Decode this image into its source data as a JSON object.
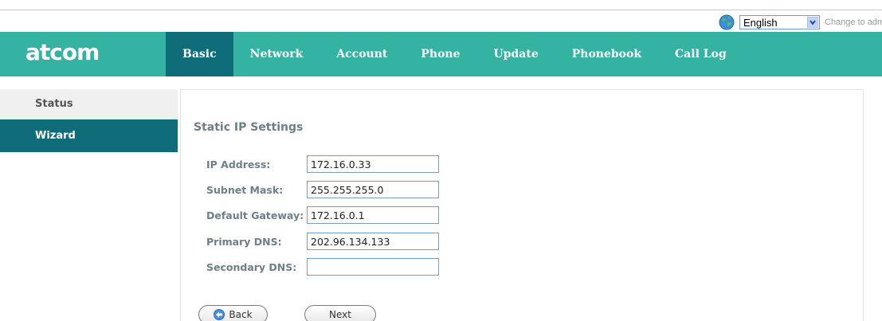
{
  "language": {
    "selected": "English",
    "change_text": "Change to admi"
  },
  "brand": {
    "logo": "atcom"
  },
  "nav": {
    "items": [
      {
        "label": "Basic",
        "active": true
      },
      {
        "label": "Network",
        "active": false
      },
      {
        "label": "Account",
        "active": false
      },
      {
        "label": "Phone",
        "active": false
      },
      {
        "label": "Update",
        "active": false
      },
      {
        "label": "Phonebook",
        "active": false
      },
      {
        "label": "Call Log",
        "active": false
      }
    ]
  },
  "sidebar": {
    "items": [
      {
        "label": "Status",
        "active": false
      },
      {
        "label": "Wizard",
        "active": true
      }
    ]
  },
  "form": {
    "title": "Static IP Settings",
    "fields": [
      {
        "label": "IP Address:",
        "value": "172.16.0.33"
      },
      {
        "label": "Subnet Mask:",
        "value": "255.255.255.0"
      },
      {
        "label": "Default Gateway:",
        "value": "172.16.0.1"
      },
      {
        "label": "Primary DNS:",
        "value": "202.96.134.133"
      },
      {
        "label": "Secondary DNS:",
        "value": ""
      }
    ],
    "back_label": "Back",
    "next_label": "Next"
  },
  "colors": {
    "nav_bg": "#34b2a2",
    "nav_active": "#0e6d78",
    "label_text": "#6d7f87"
  }
}
